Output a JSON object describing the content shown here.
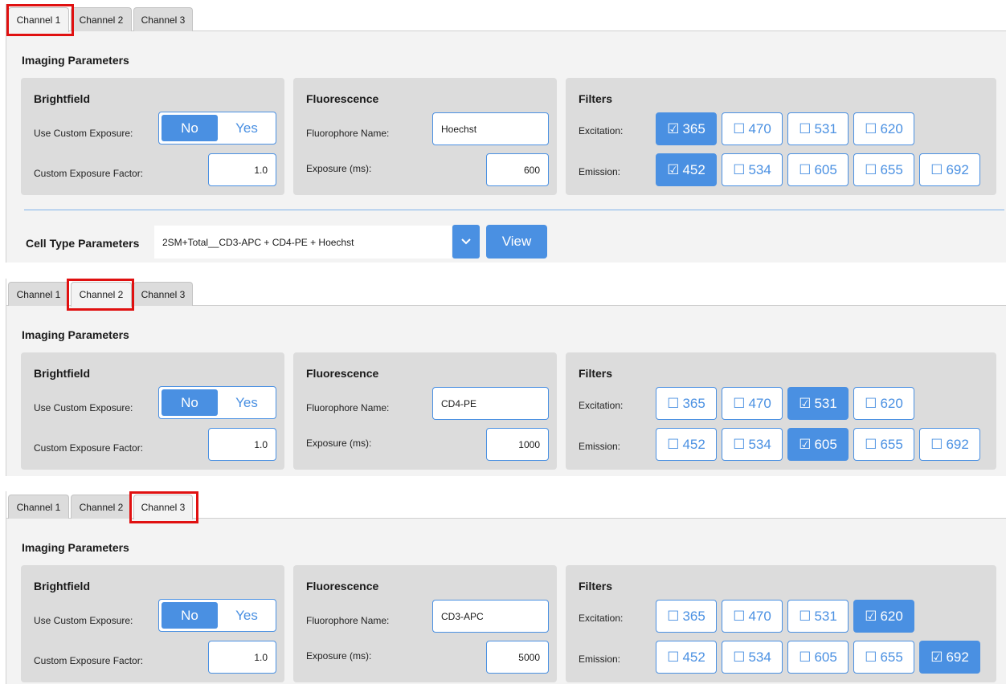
{
  "tabs": [
    "Channel 1",
    "Channel 2",
    "Channel 3"
  ],
  "labels": {
    "imaging_parameters": "Imaging Parameters",
    "brightfield": "Brightfield",
    "use_custom_exposure": "Use Custom Exposure:",
    "custom_exposure_factor": "Custom Exposure Factor:",
    "fluorescence": "Fluorescence",
    "fluorophore_name": "Fluorophore Name:",
    "exposure_ms": "Exposure (ms):",
    "filters": "Filters",
    "excitation": "Excitation:",
    "emission": "Emission:",
    "no": "No",
    "yes": "Yes"
  },
  "excitation_options": [
    "365",
    "470",
    "531",
    "620"
  ],
  "emission_options": [
    "452",
    "534",
    "605",
    "655",
    "692"
  ],
  "panels": [
    {
      "active_tab": 0,
      "custom_exposure": "No",
      "custom_exposure_factor": "1.0",
      "fluorophore_name": "Hoechst",
      "exposure_ms": "600",
      "excitation_selected": "365",
      "emission_selected": "452"
    },
    {
      "active_tab": 1,
      "custom_exposure": "No",
      "custom_exposure_factor": "1.0",
      "fluorophore_name": "CD4-PE",
      "exposure_ms": "1000",
      "excitation_selected": "531",
      "emission_selected": "605"
    },
    {
      "active_tab": 2,
      "custom_exposure": "No",
      "custom_exposure_factor": "1.0",
      "fluorophore_name": "CD3-APC",
      "exposure_ms": "5000",
      "excitation_selected": "620",
      "emission_selected": "692"
    }
  ],
  "cell_type": {
    "label": "Cell Type Parameters",
    "value": "2SM+Total__CD3-APC + CD4-PE + Hoechst",
    "view_label": "View"
  },
  "colors": {
    "accent": "#4a90e2",
    "highlight": "#e01010"
  },
  "icons": {
    "checked": "☑",
    "unchecked": "☐",
    "dropdown": "chevron-down-icon"
  }
}
